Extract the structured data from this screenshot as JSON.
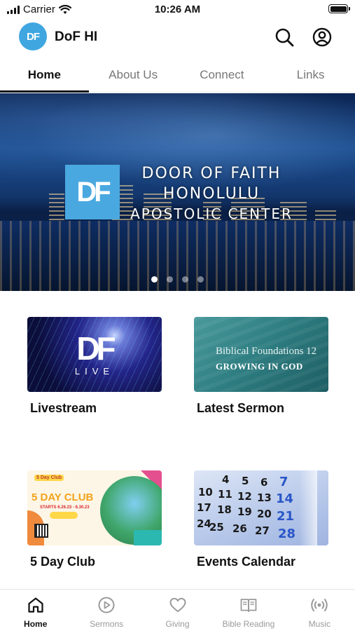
{
  "status_bar": {
    "carrier": "Carrier",
    "time": "10:26 AM"
  },
  "header": {
    "logo_text": "DF",
    "title": "DoF HI",
    "icons": [
      "search-icon",
      "account-icon"
    ]
  },
  "tabs": [
    {
      "label": "Home",
      "active": true
    },
    {
      "label": "About Us",
      "active": false
    },
    {
      "label": "Connect",
      "active": false
    },
    {
      "label": "Links",
      "active": false
    }
  ],
  "hero": {
    "logo_text": "DF",
    "line1": "DOOR OF FAITH",
    "line2": "HONOLULU",
    "line3": "APOSTOLIC CENTER",
    "slide_count": 4,
    "active_slide": 1
  },
  "tiles": [
    {
      "label": "Livestream",
      "image": {
        "logo": "DF",
        "caption": "LIVE"
      }
    },
    {
      "label": "Latest Sermon",
      "image": {
        "line1": "Biblical Foundations 12",
        "line2": "GROWING IN GOD"
      }
    },
    {
      "label": "5 Day Club",
      "image": {
        "badge": "5 Day Club",
        "title": "5 DAY CLUB",
        "dates": "STARTS 6.26.23 - 6.30.23"
      }
    },
    {
      "label": "Events Calendar",
      "image": {
        "numbers": [
          "4",
          "5",
          "6",
          "7",
          "10",
          "11",
          "12",
          "13",
          "14",
          "17",
          "18",
          "19",
          "20",
          "21",
          "24",
          "25",
          "26",
          "27",
          "28"
        ]
      }
    }
  ],
  "bottom_nav": [
    {
      "label": "Home",
      "icon": "home-icon",
      "active": true
    },
    {
      "label": "Sermons",
      "icon": "play-circle-icon",
      "active": false
    },
    {
      "label": "Giving",
      "icon": "heart-icon",
      "active": false
    },
    {
      "label": "Bible Reading",
      "icon": "book-icon",
      "active": false
    },
    {
      "label": "Music",
      "icon": "broadcast-icon",
      "active": false
    }
  ],
  "colors": {
    "brand": "#3fa6e0",
    "text": "#111111",
    "inactive": "#9a9a9a"
  }
}
